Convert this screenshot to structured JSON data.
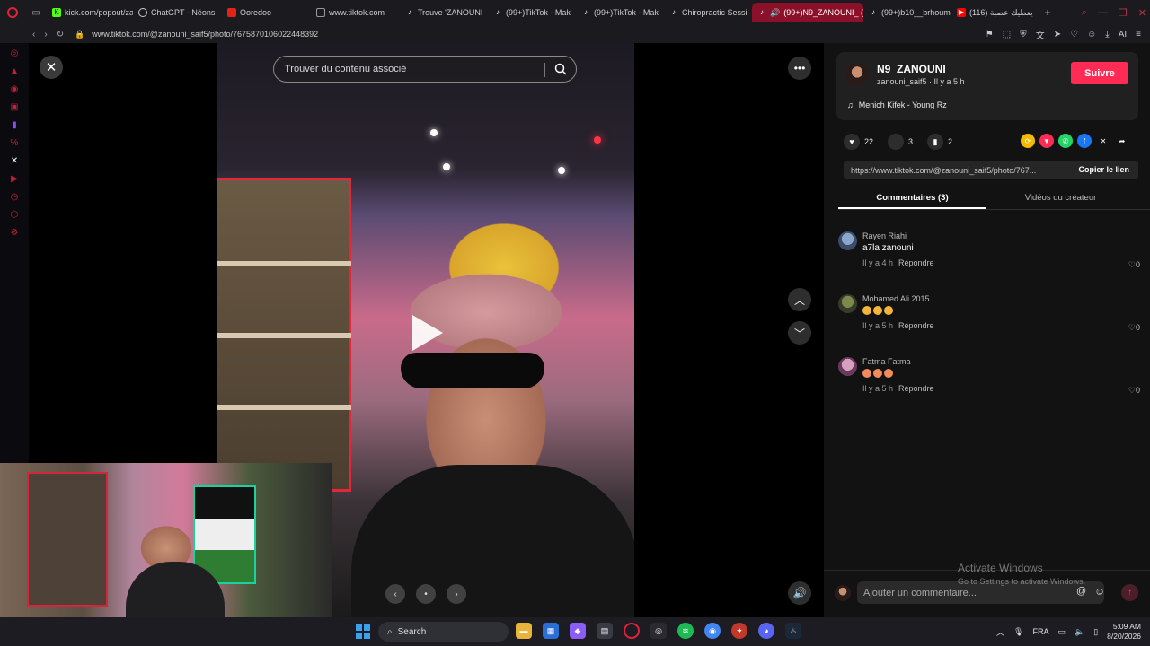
{
  "browser": {
    "tabs": [
      {
        "label": "kick.com/popout/za",
        "icon": "kick-icon",
        "color": "#53fc18"
      },
      {
        "label": "ChatGPT - Néons",
        "icon": "chatgpt-icon",
        "color": "#cccccc"
      },
      {
        "label": "Ooredoo",
        "icon": "ooredoo-icon",
        "color": "#e2231a"
      },
      {
        "label": "www.tiktok.com",
        "icon": "page-icon",
        "color": "#999999"
      },
      {
        "label": "Trouve 'ZANOUNI",
        "icon": "tiktok-icon",
        "color": "#ffffff"
      },
      {
        "label": "(99+)TikTok - Mak",
        "icon": "tiktok-icon",
        "color": "#ffffff"
      },
      {
        "label": "(99+)TikTok - Mak",
        "icon": "tiktok-icon",
        "color": "#ffffff"
      },
      {
        "label": "Chiropractic Sessi",
        "icon": "tiktok-icon",
        "color": "#ffffff"
      },
      {
        "label": "(99+)N9_ZANOUNI_ (",
        "icon": "tiktok-icon",
        "color": "#ffffff",
        "active": true
      },
      {
        "label": "(99+)b10__brhoum",
        "icon": "tiktok-icon",
        "color": "#ffffff"
      },
      {
        "label": "يعطيك عصبة (116)",
        "icon": "youtube-icon",
        "color": "#ff0000"
      }
    ],
    "url": "www.tiktok.com/@zanouni_saif5/photo/7675870106022448392"
  },
  "stage": {
    "search_placeholder": "Trouver du contenu associé"
  },
  "author": {
    "name": "N9_ZANOUNI_",
    "handle_time": "zanouni_saif5 · Il y a 5 h",
    "follow_label": "Suivre",
    "music": "Menich Kifek - Young Rz"
  },
  "stats": {
    "likes": "22",
    "comments": "3",
    "saves": "2"
  },
  "share": {
    "link": "https://www.tiktok.com/@zanouni_saif5/photo/767...",
    "copy_label": "Copier le lien"
  },
  "tabs": {
    "comments": "Commentaires (3)",
    "creator_videos": "Vidéos du créateur"
  },
  "comments": [
    {
      "name": "Rayen Riahi",
      "text": "a7la zanouni",
      "time": "Il y a 4 h",
      "reply": "Répondre",
      "likes": "0"
    },
    {
      "name": "Mohamed Ali 2015",
      "text": "",
      "emojis": 3,
      "time": "Il y a 5 h",
      "reply": "Répondre",
      "likes": "0"
    },
    {
      "name": "Fatma Fatma",
      "text": "",
      "emojis": 3,
      "time": "Il y a 5 h",
      "reply": "Répondre",
      "likes": "0"
    }
  ],
  "comment_input": {
    "placeholder": "Ajouter un commentaire..."
  },
  "watermark": {
    "title": "Activate Windows",
    "subtitle": "Go to Settings to activate Windows."
  },
  "taskbar": {
    "search": "Search",
    "language": "FRA",
    "time": "5:09 AM",
    "date": "8/20/2026"
  },
  "colors": {
    "accent": "#fe2c55",
    "active_tab": "#8a1129",
    "opera": "#e0223b"
  }
}
